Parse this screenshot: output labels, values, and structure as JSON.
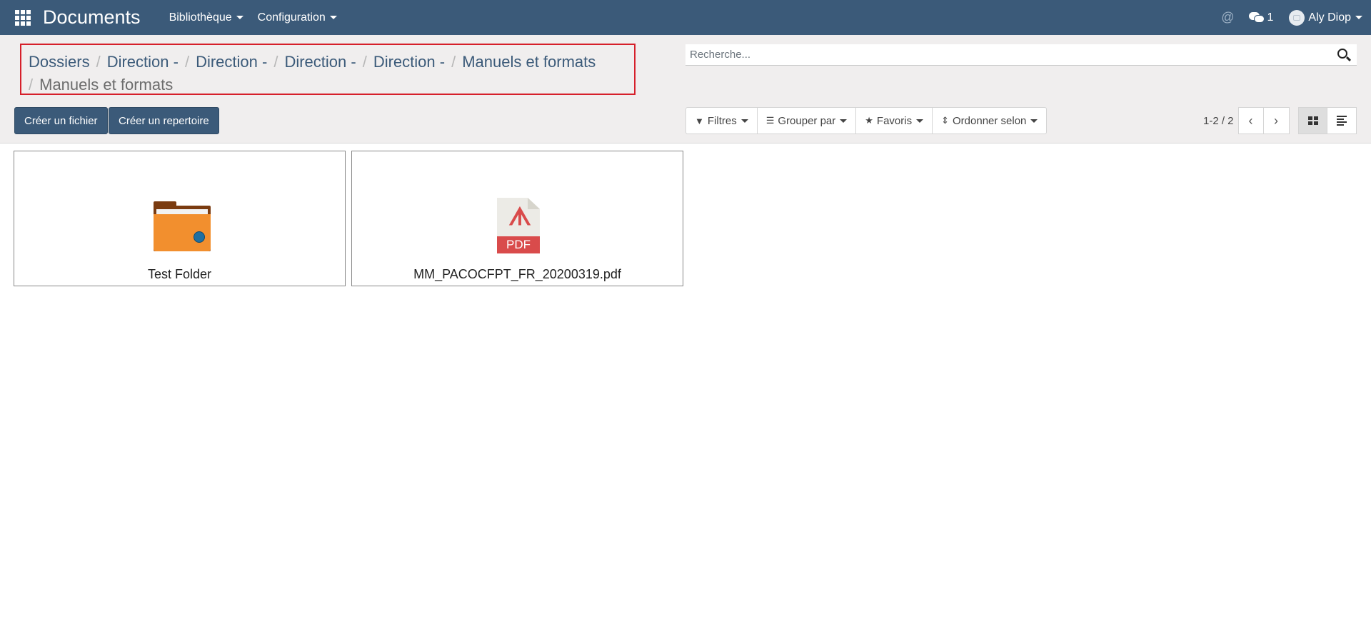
{
  "navbar": {
    "app_title": "Documents",
    "menu": [
      {
        "label": "Bibliothèque"
      },
      {
        "label": "Configuration"
      }
    ],
    "mentions_symbol": "@",
    "messages_count": "1",
    "user_name": "Aly Diop"
  },
  "breadcrumb": {
    "items": [
      "Dossiers",
      "Direction -",
      "Direction -",
      "Direction -",
      "Direction -",
      "Manuels et formats"
    ],
    "current": "Manuels et formats",
    "separator": "/"
  },
  "search": {
    "placeholder": "Recherche..."
  },
  "actions": {
    "create_file": "Créer un fichier",
    "create_folder": "Créer un repertoire"
  },
  "filters": {
    "filters_label": "Filtres",
    "group_by_label": "Grouper par",
    "favorites_label": "Favoris",
    "order_by_label": "Ordonner selon"
  },
  "pager": {
    "value": "1-2 / 2"
  },
  "records": [
    {
      "name": "Test Folder",
      "icon": "folder-icon"
    },
    {
      "name": "MM_PACOCFPT_FR_20200319.pdf",
      "icon": "pdf-icon",
      "badge": "PDF"
    }
  ],
  "colors": {
    "navbar": "#3b5a79",
    "primary": "#3b5a79",
    "highlight_border": "#d61f2a",
    "folder": "#f28f2e",
    "pdf": "#d94b4b"
  }
}
